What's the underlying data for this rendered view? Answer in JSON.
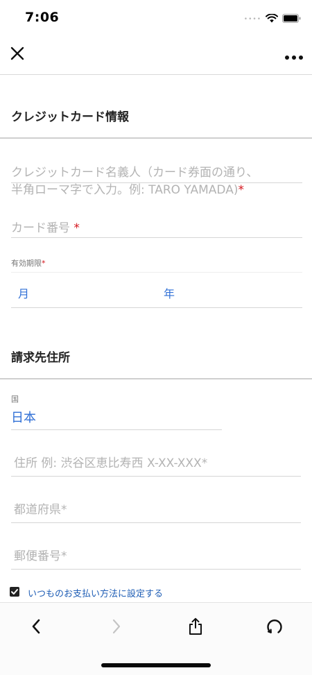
{
  "status_bar": {
    "time": "7:06"
  },
  "credit_card": {
    "section_title": "クレジットカード情報",
    "name_placeholder_line1": "クレジットカード名義人（カード券面の通り、",
    "name_placeholder_line2": "半角ローマ字で入力。例: TARO YAMADA)",
    "name_required": "*",
    "number_placeholder": "カード番号 ",
    "number_required": "*",
    "expiry_label": "有効期限",
    "expiry_required": "*",
    "expiry_month": "月",
    "expiry_year": "年"
  },
  "billing": {
    "section_title": "請求先住所",
    "country_label": "国",
    "country_value": "日本",
    "address_placeholder": "住所 例: 渋谷区恵比寿西 X-XX-XXX*",
    "prefecture_placeholder": "都道府県*",
    "postal_placeholder": "郵便番号*"
  },
  "default_payment": {
    "label": "いつものお支払い方法に設定する",
    "checked": true
  },
  "icons": [
    "close-icon",
    "more-icon",
    "back-icon",
    "forward-icon",
    "share-icon",
    "reload-icon",
    "wifi-icon",
    "battery-icon"
  ],
  "colors": {
    "accent_blue": "#2f6fd6",
    "required_red": "#d4141c",
    "placeholder_gray": "#b3b3b3"
  }
}
